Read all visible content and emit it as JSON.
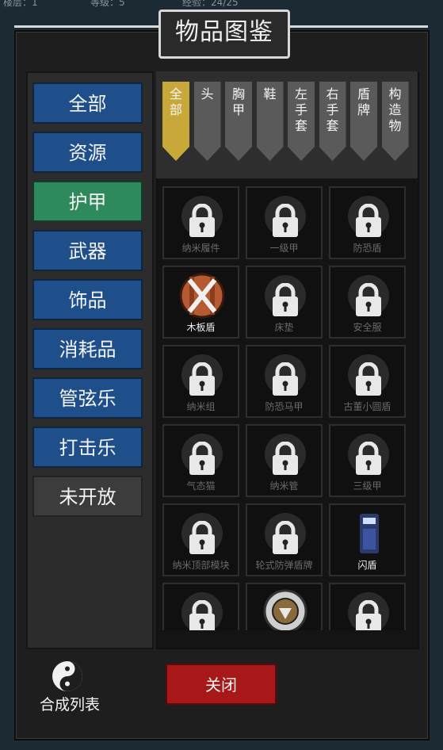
{
  "top_status": {
    "floor": "楼层：1",
    "level": "等级：5",
    "exp": "经验：24/25"
  },
  "title": "物品图鉴",
  "categories": [
    {
      "label": "全部",
      "state": "normal"
    },
    {
      "label": "资源",
      "state": "normal"
    },
    {
      "label": "护甲",
      "state": "active"
    },
    {
      "label": "武器",
      "state": "normal"
    },
    {
      "label": "饰品",
      "state": "normal"
    },
    {
      "label": "消耗品",
      "state": "normal"
    },
    {
      "label": "管弦乐",
      "state": "normal"
    },
    {
      "label": "打击乐",
      "state": "normal"
    },
    {
      "label": "未开放",
      "state": "disabled"
    }
  ],
  "tabs": [
    {
      "label": "全部",
      "active": true
    },
    {
      "label": "头",
      "active": false
    },
    {
      "label": "胸甲",
      "active": false
    },
    {
      "label": "鞋",
      "active": false
    },
    {
      "label": "左手套",
      "active": false
    },
    {
      "label": "右手套",
      "active": false
    },
    {
      "label": "盾牌",
      "active": false
    },
    {
      "label": "构造物",
      "active": false
    }
  ],
  "items": [
    {
      "name": "纳米履件",
      "unlocked": false
    },
    {
      "name": "一级甲",
      "unlocked": false
    },
    {
      "name": "防恐盾",
      "unlocked": false
    },
    {
      "name": "木板盾",
      "unlocked": true,
      "icon": "wood-shield-icon"
    },
    {
      "name": "床垫",
      "unlocked": false
    },
    {
      "name": "安全服",
      "unlocked": false
    },
    {
      "name": "纳米组",
      "unlocked": false
    },
    {
      "name": "防恐马甲",
      "unlocked": false
    },
    {
      "name": "古董小圆盾",
      "unlocked": false
    },
    {
      "name": "气态猫",
      "unlocked": false
    },
    {
      "name": "纳米管",
      "unlocked": false
    },
    {
      "name": "三级甲",
      "unlocked": false
    },
    {
      "name": "纳米顶部模块",
      "unlocked": false
    },
    {
      "name": "轮式防弹盾牌",
      "unlocked": false
    },
    {
      "name": "闪盾",
      "unlocked": true,
      "icon": "flash-shield-icon"
    },
    {
      "name": "",
      "unlocked": false
    },
    {
      "name": "",
      "unlocked": true,
      "icon": "round-shield-icon"
    },
    {
      "name": "",
      "unlocked": false
    }
  ],
  "bottom": {
    "synth_label": "合成列表",
    "close_label": "关闭"
  },
  "colors": {
    "category_blue": "#1f4f8a",
    "category_active": "#2e8a5c",
    "tab_active": "#c9a83a",
    "close_red": "#a81818"
  }
}
